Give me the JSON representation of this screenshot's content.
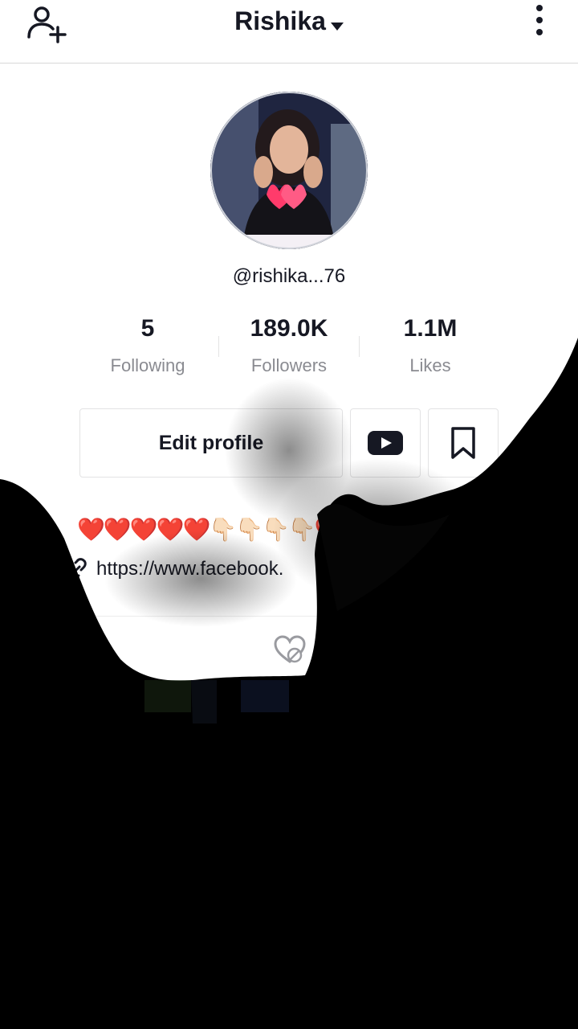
{
  "header": {
    "title": "Rishika",
    "add_user_icon": "add-user-icon",
    "more_icon": "more-vertical-icon"
  },
  "profile": {
    "handle": "@rishika...76",
    "stats": [
      {
        "value": "5",
        "label": "Following"
      },
      {
        "value": "189.0K",
        "label": "Followers"
      },
      {
        "value": "1.1M",
        "label": "Likes"
      }
    ],
    "edit_label": "Edit profile",
    "youtube_icon": "youtube-icon",
    "bookmark_icon": "bookmark-icon",
    "bio": "❤️❤️❤️❤️❤️👇🏻👇🏻👇🏻👇🏻❤️❤️",
    "link": "https://www.facebook."
  },
  "tabs": {
    "videos_icon": "grid-icon",
    "liked_icon": "hidden-likes-icon"
  },
  "colors": {
    "text": "#161823",
    "secondary": "#8a8b91",
    "border": "#e3e3e4",
    "overlay": "#000000"
  }
}
